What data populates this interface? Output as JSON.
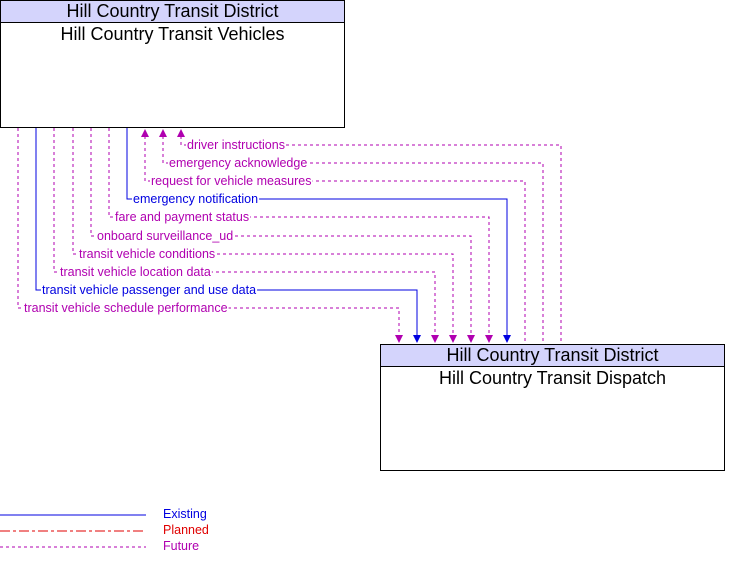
{
  "colors": {
    "existing": "#0000e0",
    "planned": "#e00000",
    "future": "#b000b0"
  },
  "entities": {
    "vehicles": {
      "owner": "Hill Country Transit District",
      "name": "Hill Country Transit Vehicles"
    },
    "dispatch": {
      "owner": "Hill Country Transit District",
      "name": "Hill Country Transit Dispatch"
    }
  },
  "flows": [
    {
      "label": "driver instructions",
      "status": "future",
      "direction": "to_vehicles"
    },
    {
      "label": "emergency acknowledge",
      "status": "future",
      "direction": "to_vehicles"
    },
    {
      "label": "request for vehicle measures",
      "status": "future",
      "direction": "to_vehicles"
    },
    {
      "label": "emergency notification",
      "status": "existing",
      "direction": "to_dispatch"
    },
    {
      "label": "fare and payment status",
      "status": "future",
      "direction": "to_dispatch"
    },
    {
      "label": "onboard surveillance_ud",
      "status": "future",
      "direction": "to_dispatch"
    },
    {
      "label": "transit vehicle conditions",
      "status": "future",
      "direction": "to_dispatch"
    },
    {
      "label": "transit vehicle location data",
      "status": "future",
      "direction": "to_dispatch"
    },
    {
      "label": "transit vehicle passenger and use data",
      "status": "existing",
      "direction": "to_dispatch"
    },
    {
      "label": "transit vehicle schedule performance",
      "status": "future",
      "direction": "to_dispatch"
    }
  ],
  "legend": [
    {
      "label": "Existing",
      "status": "existing"
    },
    {
      "label": "Planned",
      "status": "planned"
    },
    {
      "label": "Future",
      "status": "future"
    }
  ]
}
